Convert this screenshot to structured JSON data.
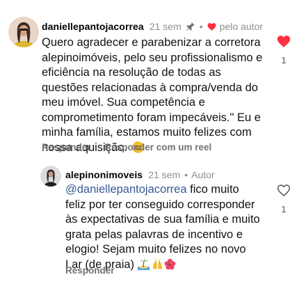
{
  "comments": [
    {
      "username": "daniellepantojacorrea",
      "time": "21 sem",
      "author_label": "pelo autor",
      "text_lines": [
        "Quero agradecer e parabenizar a corretora",
        "alepinoimóveis, pelo seu profissionalismo e",
        "eficiência na resolução de todas as",
        "questões relacionadas à compra/venda do",
        "meu imóvel. Sua competência e",
        "comprometimento foram impecáveis.\" Eu e",
        "minha família, estamos muito felizes com",
        "nossa aquisição."
      ],
      "emoji": "smiling-face",
      "actions": [
        "Responder",
        "Responder com um reel"
      ],
      "likes": "1",
      "liked": true
    },
    {
      "username": "alepinonimoveis",
      "time": "21 sem",
      "author_label": "Autor",
      "mention": "@daniellepantojacorrea",
      "text_first_rest": " fico muito",
      "text_lines": [
        "feliz por ter conseguido corresponder",
        "às expectativas de sua família e muito",
        "grata pelas palavras de incentivo e",
        "elogio! Sejam muito felizes no novo",
        "Lar (de praia)"
      ],
      "emojis": [
        "desert-island",
        "raising-hands",
        "hibiscus"
      ],
      "actions": [
        "Responder"
      ],
      "likes": "1",
      "liked": false
    }
  ],
  "colors": {
    "heart_red": "#ff3040",
    "mention_blue": "#385898",
    "muted_gray": "#8e8e8e"
  }
}
